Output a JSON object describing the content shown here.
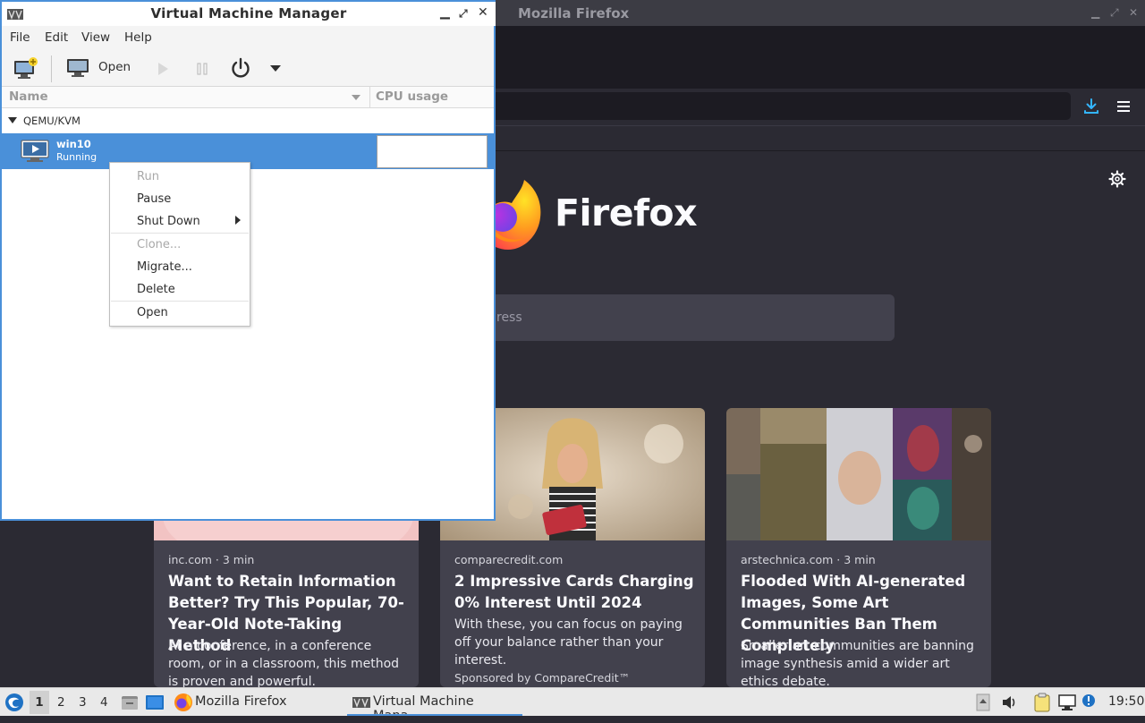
{
  "firefox": {
    "window_title": "Mozilla Firefox",
    "search_placeholder": "ress",
    "cards": [
      {
        "source": "inc.com · 3 min",
        "title": "Want to Retain Information Better? Try This Popular, 70-Year-Old Note-Taking Method",
        "description": "At a conference, in a conference room, or in a classroom, this method is proven and powerful.",
        "sponsor": ""
      },
      {
        "source": "comparecredit.com",
        "title": "2 Impressive Cards Charging 0% Interest Until 2024",
        "description": "With these, you can focus on paying off your balance rather than your interest.",
        "sponsor": "Sponsored by CompareCredit™"
      },
      {
        "source": "arstechnica.com · 3 min",
        "title": "Flooded With AI-generated Images, Some Art Communities Ban Them Completely",
        "description": "Smaller art communities are banning image synthesis amid a wider art ethics debate.",
        "sponsor": ""
      }
    ],
    "wordmark": "Firefox"
  },
  "vmm": {
    "window_title": "Virtual Machine Manager",
    "menus": [
      "File",
      "Edit",
      "View",
      "Help"
    ],
    "toolbar": {
      "open_label": "Open"
    },
    "columns": {
      "name": "Name",
      "cpu": "CPU usage"
    },
    "group": "QEMU/KVM",
    "vm": {
      "name": "win10",
      "state": "Running"
    }
  },
  "context_menu": {
    "items": [
      "Run",
      "Pause",
      "Shut Down",
      "Clone...",
      "Migrate...",
      "Delete",
      "Open"
    ],
    "disabled": [
      "Run",
      "Clone..."
    ]
  },
  "taskbar": {
    "workspaces": [
      "1",
      "2",
      "3",
      "4"
    ],
    "active_workspace": "1",
    "tasks": [
      "Mozilla Firefox",
      "Virtual Machine Mana..."
    ],
    "clock": "19:50"
  },
  "colors": {
    "vmm_accent": "#4a90d9",
    "firefox_bg": "#2b2a33",
    "firefox_card": "#42414d"
  }
}
